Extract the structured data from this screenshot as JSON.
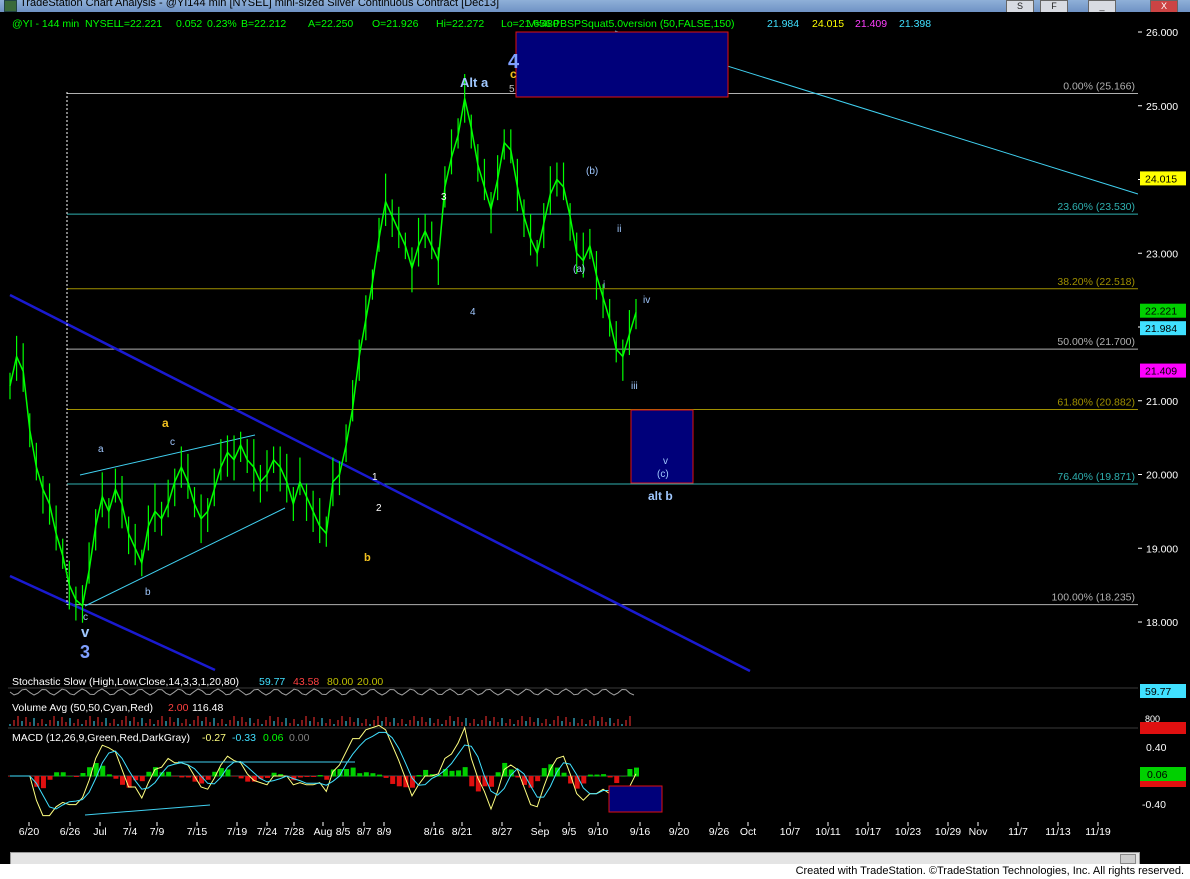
{
  "window": {
    "title": "TradeStation Chart Analysis - @YI144 min [NYSEL] mini-sized Silver Continuous Contract [Dec13]",
    "buttons": [
      "S",
      "F",
      "_",
      "X"
    ]
  },
  "header": {
    "symbol": "@YI - 144 min",
    "exchange": "NYSEL",
    "fields": [
      "L=22.221",
      "0.052",
      "0.23%",
      "B=22.212",
      "A=22.250",
      "O=21.926",
      "Hi=22.272",
      "Lo=21.656",
      "V=480"
    ],
    "indicator": "PBSPSquat5.0version (50,FALSE,150)",
    "indicator_values": [
      {
        "value": "21.984",
        "color": "#40e0ff"
      },
      {
        "value": "24.015",
        "color": "#ffff00"
      },
      {
        "value": "21.409",
        "color": "#ff40ff"
      },
      {
        "value": "21.398",
        "color": "#40e0ff"
      }
    ]
  },
  "chart_data": {
    "type": "line",
    "ylim": [
      17.45,
      26.05
    ],
    "yticks": [
      "26.000",
      "25.000",
      "24.000",
      "23.000",
      "22.000",
      "21.000",
      "20.000",
      "19.000",
      "18.000"
    ],
    "xticks": [
      "6/20",
      "6/26",
      "Jul",
      "7/4",
      "7/9",
      "7/15",
      "7/19",
      "7/24",
      "7/28",
      "Aug",
      "8/5",
      "8/7",
      "8/9",
      "8/16",
      "8/21",
      "8/27",
      "Sep",
      "9/5",
      "9/10",
      "9/16",
      "9/20",
      "9/26",
      "Oct",
      "10/7",
      "10/11",
      "10/17",
      "10/23",
      "10/29",
      "Nov",
      "11/7",
      "11/13",
      "11/19"
    ],
    "series": [
      {
        "values": [
          21.2,
          21.6,
          21.4,
          20.6,
          20.1,
          19.8,
          19.6,
          19.2,
          18.9,
          18.5,
          18.3,
          18.22,
          18.7,
          19.3,
          19.7,
          19.5,
          19.8,
          19.6,
          19.2,
          19.0,
          18.8,
          19.3,
          19.5,
          19.4,
          19.6,
          19.9,
          20.1,
          19.9,
          19.6,
          19.4,
          19.5,
          19.8,
          20.1,
          20.3,
          20.2,
          20.4,
          20.2,
          20.1,
          19.9,
          20.0,
          20.2,
          20.1,
          19.9,
          19.6,
          19.9,
          19.7,
          19.5,
          19.3,
          19.2,
          19.9,
          20.0,
          20.4,
          20.9,
          21.6,
          22.1,
          22.6,
          23.2,
          23.7,
          23.5,
          23.3,
          23.1,
          22.8,
          23.1,
          23.3,
          23.1,
          22.9,
          23.9,
          24.3,
          24.6,
          25.1,
          24.7,
          24.2,
          23.9,
          23.6,
          24.0,
          24.5,
          24.4,
          23.9,
          23.5,
          23.2,
          23.0,
          23.4,
          23.8,
          24.0,
          23.9,
          23.5,
          23.0,
          22.9,
          23.1,
          22.7,
          22.4,
          22.1,
          21.7,
          21.6,
          21.9,
          22.2
        ]
      }
    ],
    "fib_levels": [
      {
        "label": "0.00% (25.166)",
        "value": 25.166
      },
      {
        "label": "23.60% (23.530)",
        "value": 23.53
      },
      {
        "label": "38.20% (22.518)",
        "value": 22.518
      },
      {
        "label": "50.00% (21.700)",
        "value": 21.7
      },
      {
        "label": "61.80% (20.882)",
        "value": 20.882
      },
      {
        "label": "76.40% (19.871)",
        "value": 19.871
      },
      {
        "label": "100.00% (18.235)",
        "value": 18.235
      }
    ],
    "price_tags": [
      {
        "value": "24.015",
        "price": 24.015,
        "bg": "#ffff00",
        "fg": "#000000"
      },
      {
        "value": "22.221",
        "price": 22.221,
        "bg": "#00d000",
        "fg": "#000000"
      },
      {
        "value": "21.984",
        "price": 21.984,
        "bg": "#40e0ff",
        "fg": "#000000"
      },
      {
        "value": "21.409",
        "price": 21.409,
        "bg": "#ff00ff",
        "fg": "#000000"
      }
    ],
    "annotations": [
      "Alt a",
      "4",
      "c",
      "5",
      "3",
      "4",
      "(b)",
      "(a)",
      "ii",
      "i",
      "iv",
      "iii",
      "v",
      "(c)",
      "alt b",
      "a",
      "c",
      "a",
      "b",
      "b",
      "2",
      "1",
      "c",
      "v",
      "3"
    ]
  },
  "indicators": {
    "stochastic": {
      "label": "Stochastic Slow (High,Low,Close,14,3,3,1,20,80)",
      "values": [
        "59.77",
        "43.58",
        "80.00",
        "20.00"
      ],
      "tag": "59.77"
    },
    "volume": {
      "label": "Volume Avg (50,50,Cyan,Red)",
      "values": [
        "2.00",
        "116.48"
      ],
      "tag": "800"
    },
    "macd": {
      "label": "MACD (12,26,9,Green,Red,DarkGray)",
      "values": [
        "-0.27",
        "-0.33",
        "0.06",
        "0.00"
      ],
      "yticks": [
        "0.40",
        "-0.40"
      ],
      "tag": "0.06",
      "tag_red": "0.00"
    }
  },
  "footer": "Created with TradeStation. ©TradeStation Technologies, Inc. All rights reserved.",
  "colors": {
    "price": "#00ff00",
    "fib_cyan": "#2fb0b0",
    "fib_gold": "#a09000",
    "fib_gray": "#b0b0b0",
    "channel": "#1a1ad0",
    "box": "#00007a",
    "box_border": "#e01010",
    "trend": "#40d0f0"
  }
}
